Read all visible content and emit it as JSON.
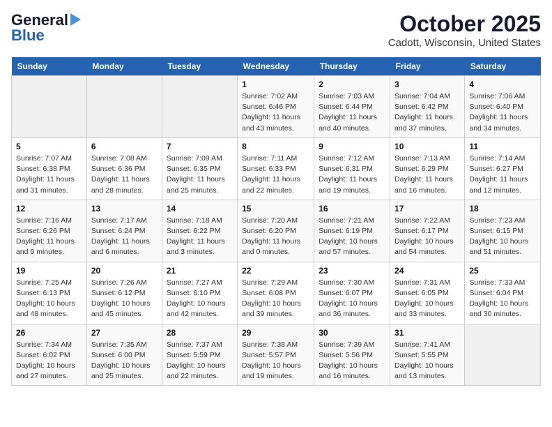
{
  "header": {
    "logo_general": "General",
    "logo_blue": "Blue",
    "month_title": "October 2025",
    "location": "Cadott, Wisconsin, United States"
  },
  "days_of_week": [
    "Sunday",
    "Monday",
    "Tuesday",
    "Wednesday",
    "Thursday",
    "Friday",
    "Saturday"
  ],
  "weeks": [
    [
      {
        "day": "",
        "info": ""
      },
      {
        "day": "",
        "info": ""
      },
      {
        "day": "",
        "info": ""
      },
      {
        "day": "1",
        "info": "Sunrise: 7:02 AM\nSunset: 6:46 PM\nDaylight: 11 hours and 43 minutes."
      },
      {
        "day": "2",
        "info": "Sunrise: 7:03 AM\nSunset: 6:44 PM\nDaylight: 11 hours and 40 minutes."
      },
      {
        "day": "3",
        "info": "Sunrise: 7:04 AM\nSunset: 6:42 PM\nDaylight: 11 hours and 37 minutes."
      },
      {
        "day": "4",
        "info": "Sunrise: 7:06 AM\nSunset: 6:40 PM\nDaylight: 11 hours and 34 minutes."
      }
    ],
    [
      {
        "day": "5",
        "info": "Sunrise: 7:07 AM\nSunset: 6:38 PM\nDaylight: 11 hours and 31 minutes."
      },
      {
        "day": "6",
        "info": "Sunrise: 7:08 AM\nSunset: 6:36 PM\nDaylight: 11 hours and 28 minutes."
      },
      {
        "day": "7",
        "info": "Sunrise: 7:09 AM\nSunset: 6:35 PM\nDaylight: 11 hours and 25 minutes."
      },
      {
        "day": "8",
        "info": "Sunrise: 7:11 AM\nSunset: 6:33 PM\nDaylight: 11 hours and 22 minutes."
      },
      {
        "day": "9",
        "info": "Sunrise: 7:12 AM\nSunset: 6:31 PM\nDaylight: 11 hours and 19 minutes."
      },
      {
        "day": "10",
        "info": "Sunrise: 7:13 AM\nSunset: 6:29 PM\nDaylight: 11 hours and 16 minutes."
      },
      {
        "day": "11",
        "info": "Sunrise: 7:14 AM\nSunset: 6:27 PM\nDaylight: 11 hours and 12 minutes."
      }
    ],
    [
      {
        "day": "12",
        "info": "Sunrise: 7:16 AM\nSunset: 6:26 PM\nDaylight: 11 hours and 9 minutes."
      },
      {
        "day": "13",
        "info": "Sunrise: 7:17 AM\nSunset: 6:24 PM\nDaylight: 11 hours and 6 minutes."
      },
      {
        "day": "14",
        "info": "Sunrise: 7:18 AM\nSunset: 6:22 PM\nDaylight: 11 hours and 3 minutes."
      },
      {
        "day": "15",
        "info": "Sunrise: 7:20 AM\nSunset: 6:20 PM\nDaylight: 11 hours and 0 minutes."
      },
      {
        "day": "16",
        "info": "Sunrise: 7:21 AM\nSunset: 6:19 PM\nDaylight: 10 hours and 57 minutes."
      },
      {
        "day": "17",
        "info": "Sunrise: 7:22 AM\nSunset: 6:17 PM\nDaylight: 10 hours and 54 minutes."
      },
      {
        "day": "18",
        "info": "Sunrise: 7:23 AM\nSunset: 6:15 PM\nDaylight: 10 hours and 51 minutes."
      }
    ],
    [
      {
        "day": "19",
        "info": "Sunrise: 7:25 AM\nSunset: 6:13 PM\nDaylight: 10 hours and 48 minutes."
      },
      {
        "day": "20",
        "info": "Sunrise: 7:26 AM\nSunset: 6:12 PM\nDaylight: 10 hours and 45 minutes."
      },
      {
        "day": "21",
        "info": "Sunrise: 7:27 AM\nSunset: 6:10 PM\nDaylight: 10 hours and 42 minutes."
      },
      {
        "day": "22",
        "info": "Sunrise: 7:29 AM\nSunset: 6:08 PM\nDaylight: 10 hours and 39 minutes."
      },
      {
        "day": "23",
        "info": "Sunrise: 7:30 AM\nSunset: 6:07 PM\nDaylight: 10 hours and 36 minutes."
      },
      {
        "day": "24",
        "info": "Sunrise: 7:31 AM\nSunset: 6:05 PM\nDaylight: 10 hours and 33 minutes."
      },
      {
        "day": "25",
        "info": "Sunrise: 7:33 AM\nSunset: 6:04 PM\nDaylight: 10 hours and 30 minutes."
      }
    ],
    [
      {
        "day": "26",
        "info": "Sunrise: 7:34 AM\nSunset: 6:02 PM\nDaylight: 10 hours and 27 minutes."
      },
      {
        "day": "27",
        "info": "Sunrise: 7:35 AM\nSunset: 6:00 PM\nDaylight: 10 hours and 25 minutes."
      },
      {
        "day": "28",
        "info": "Sunrise: 7:37 AM\nSunset: 5:59 PM\nDaylight: 10 hours and 22 minutes."
      },
      {
        "day": "29",
        "info": "Sunrise: 7:38 AM\nSunset: 5:57 PM\nDaylight: 10 hours and 19 minutes."
      },
      {
        "day": "30",
        "info": "Sunrise: 7:39 AM\nSunset: 5:56 PM\nDaylight: 10 hours and 16 minutes."
      },
      {
        "day": "31",
        "info": "Sunrise: 7:41 AM\nSunset: 5:55 PM\nDaylight: 10 hours and 13 minutes."
      },
      {
        "day": "",
        "info": ""
      }
    ]
  ]
}
